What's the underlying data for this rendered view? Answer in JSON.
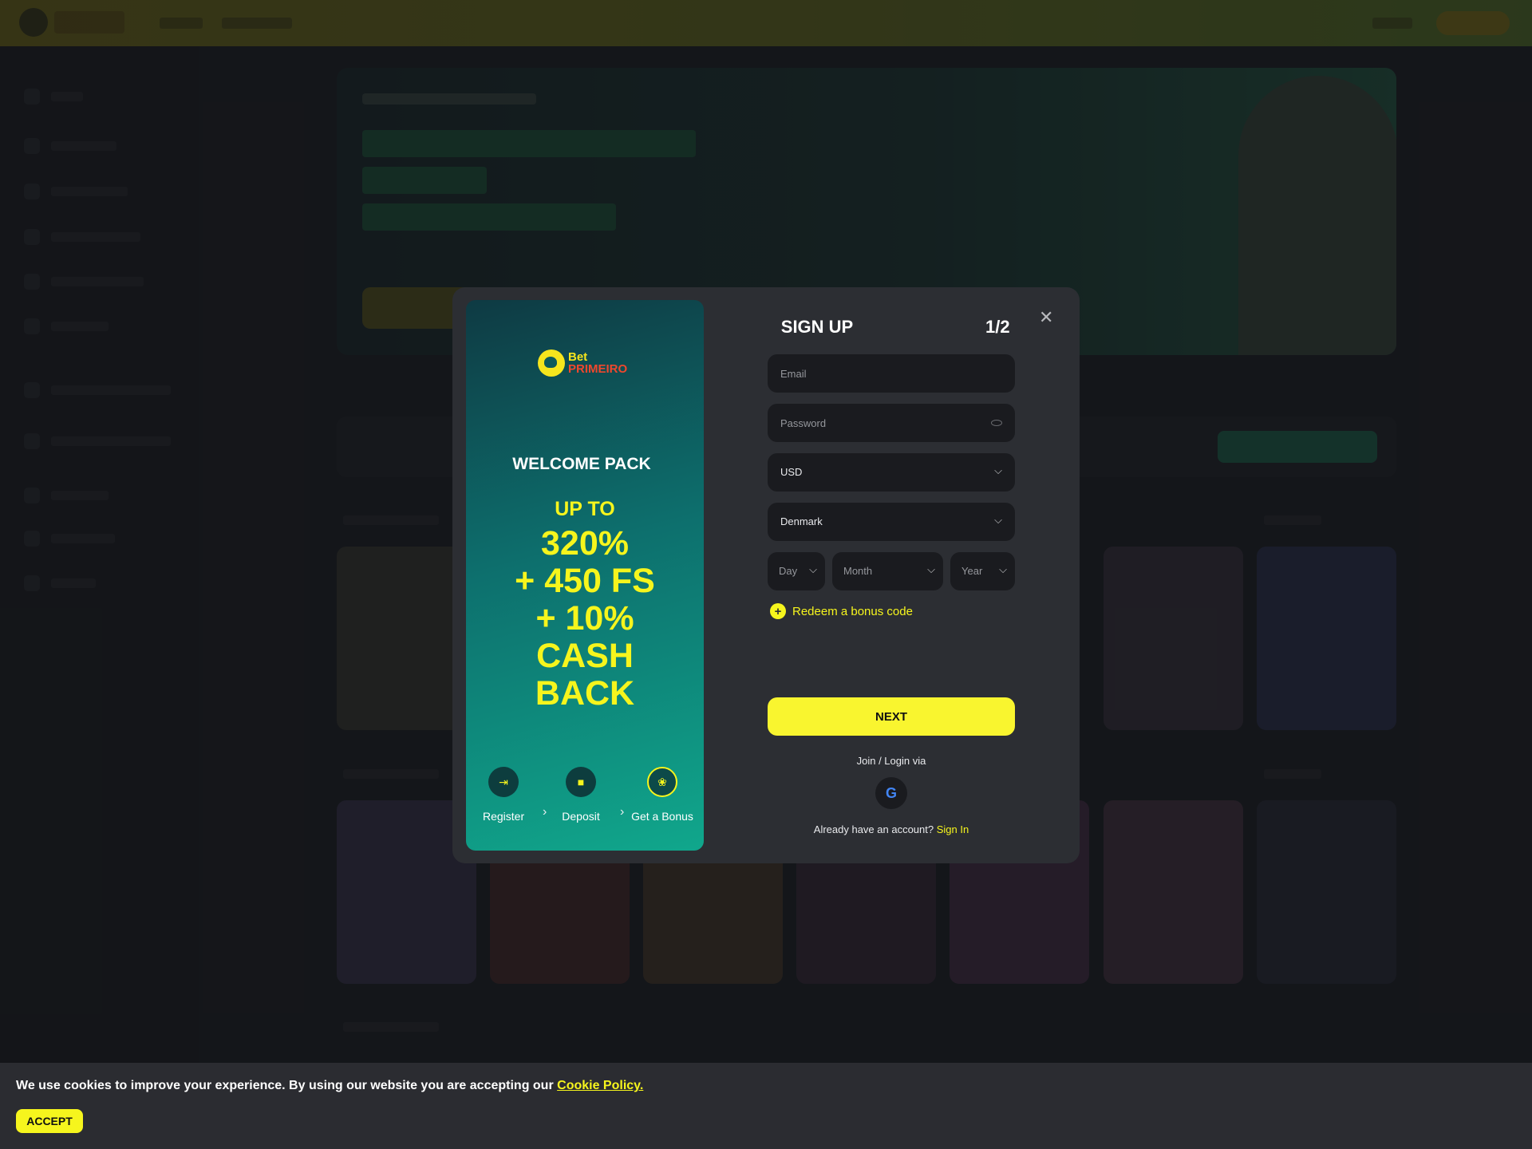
{
  "colors": {
    "accent": "#f6f51d",
    "brand_red": "#f0472d",
    "modal_bg": "#2c2e33",
    "field_bg": "#1a1b1f"
  },
  "modal": {
    "promo": {
      "brand_line1": "Bet",
      "brand_line2": "PRIMEIRO",
      "welcome": "WELCOME PACK",
      "upto": "UP TO",
      "offer_lines": [
        "320%",
        "+ 450 FS",
        "+ 10%",
        "CASH",
        "BACK"
      ],
      "steps": [
        {
          "label": "Register",
          "icon": "login-arrow-icon"
        },
        {
          "label": "Deposit",
          "icon": "wallet-icon"
        },
        {
          "label": "Get a Bonus",
          "icon": "gift-icon"
        }
      ]
    },
    "title": "SIGN UP",
    "pager": "1/2",
    "email_placeholder": "Email",
    "password_placeholder": "Password",
    "currency": "USD",
    "country": "Denmark",
    "day": "Day",
    "month": "Month",
    "year": "Year",
    "redeem_label": "Redeem a bonus code",
    "next_label": "NEXT",
    "join_label": "Join / Login via",
    "already_text": "Already have an account?",
    "sign_in_label": "Sign In"
  },
  "cookie": {
    "text": "We use cookies to improve your experience. By using our website you are accepting our",
    "policy": "Cookie Policy.",
    "accept": "ACCEPT"
  }
}
